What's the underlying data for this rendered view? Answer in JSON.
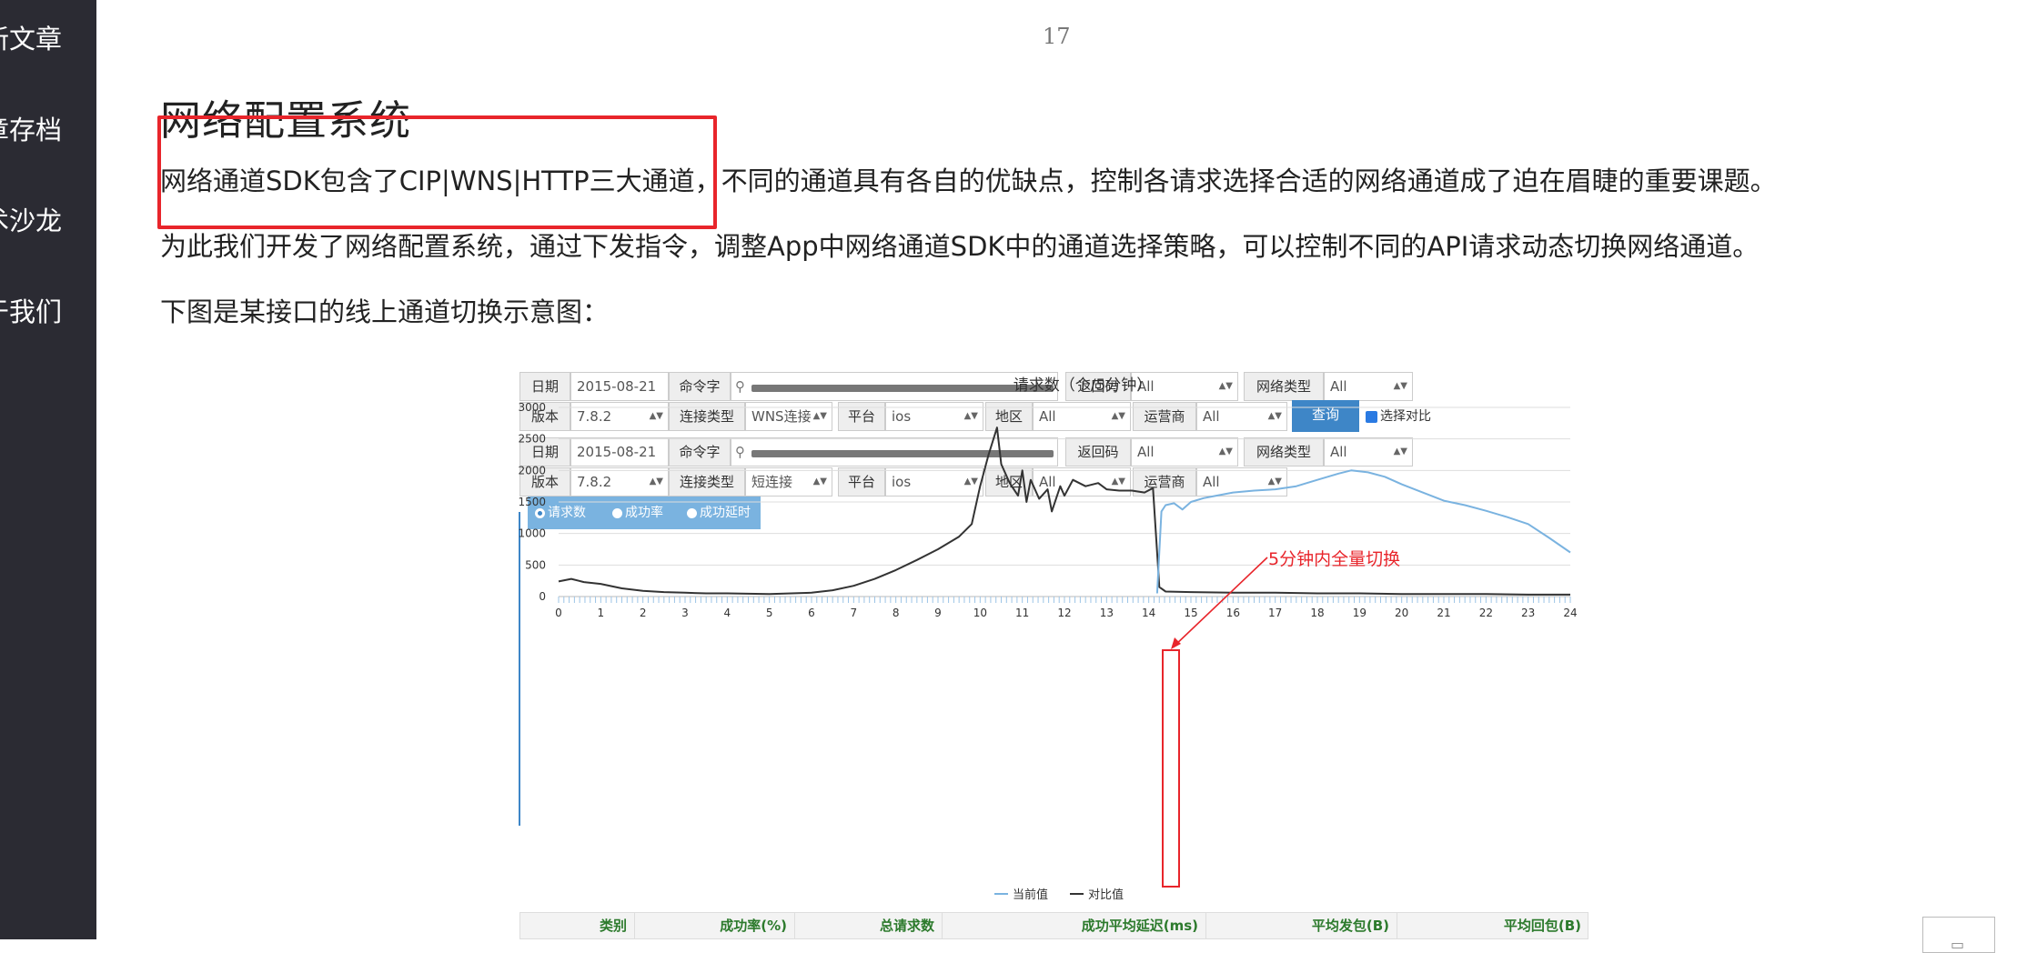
{
  "sidebar": {
    "items": [
      "新文章",
      "章存档",
      "术沙龙",
      "于我们"
    ]
  },
  "page_number": "17",
  "article": {
    "title": "网络配置系统",
    "paragraphs": [
      "网络通道SDK包含了CIP|WNS|HTTP三大通道，不同的通道具有各自的优缺点，控制各请求选择合适的网络通道成了迫在眉睫的重要课题。",
      "为此我们开发了网络配置系统，通过下发指令，调整App中网络通道SDK中的通道选择策略，可以控制不同的API请求动态切换网络通道。",
      "下图是某接口的线上通道切换示意图："
    ]
  },
  "filters": {
    "labels": {
      "date": "日期",
      "command": "命令字",
      "return_code": "返回码",
      "network_type": "网络类型",
      "version": "版本",
      "connection_type": "连接类型",
      "platform": "平台",
      "region": "地区",
      "carrier": "运营商"
    },
    "row1": {
      "date": "2015-08-21",
      "return_code": "All",
      "network_type": "All"
    },
    "row2": {
      "version": "7.8.2",
      "connection_type": "WNS连接",
      "platform": "ios",
      "region": "All",
      "carrier": "All"
    },
    "row3": {
      "date": "2015-08-21",
      "return_code": "All",
      "network_type": "All"
    },
    "row4": {
      "version": "7.8.2",
      "connection_type": "短连接",
      "platform": "ios",
      "region": "All",
      "carrier": "All"
    },
    "query_button": "查询",
    "compare_label": "选择对比"
  },
  "tabs": [
    {
      "label": "请求数",
      "selected": true
    },
    {
      "label": "成功率",
      "selected": false
    },
    {
      "label": "成功延时",
      "selected": false
    }
  ],
  "annotation": "5分钟内全量切换",
  "chart_data": {
    "type": "line",
    "title": "请求数（个/5分钟）",
    "x_ticks": [
      "0",
      "1",
      "2",
      "3",
      "4",
      "5",
      "6",
      "7",
      "8",
      "9",
      "10",
      "11",
      "12",
      "13",
      "14",
      "15",
      "16",
      "17",
      "18",
      "19",
      "20",
      "21",
      "22",
      "23",
      "24"
    ],
    "y_ticks": [
      "0",
      "500",
      "1000",
      "1500",
      "2000",
      "2500",
      "3000"
    ],
    "xlim": [
      0,
      24
    ],
    "ylim": [
      0,
      3000
    ],
    "grid": true,
    "legend_position": "bottom",
    "series": [
      {
        "name": "当前值",
        "color": "#7ab3e0",
        "x": [
          14.2,
          14.3,
          14.4,
          14.6,
          14.8,
          15.0,
          15.3,
          15.6,
          16.0,
          16.5,
          17.0,
          17.5,
          18.0,
          18.5,
          18.8,
          19.2,
          19.6,
          20.0,
          20.5,
          21.0,
          21.5,
          22.0,
          22.5,
          23.0,
          23.5,
          24.0
        ],
        "y": [
          50,
          1350,
          1450,
          1480,
          1380,
          1500,
          1560,
          1600,
          1650,
          1680,
          1700,
          1750,
          1850,
          1950,
          2000,
          1970,
          1900,
          1780,
          1650,
          1520,
          1450,
          1360,
          1260,
          1150,
          930,
          700
        ]
      },
      {
        "name": "对比值",
        "color": "#333333",
        "x": [
          0,
          0.3,
          0.6,
          1,
          1.5,
          2,
          2.5,
          3,
          3.5,
          4,
          5,
          6,
          6.5,
          7,
          7.5,
          8,
          8.5,
          9,
          9.5,
          9.8,
          10,
          10.2,
          10.4,
          10.5,
          10.7,
          10.9,
          11.0,
          11.1,
          11.2,
          11.4,
          11.6,
          11.7,
          11.9,
          12.0,
          12.2,
          12.5,
          12.8,
          13.0,
          13.3,
          13.6,
          13.9,
          14.1,
          14.25,
          14.4,
          15,
          16,
          17,
          18,
          19,
          20,
          21,
          22,
          23,
          24
        ],
        "y": [
          240,
          280,
          230,
          200,
          130,
          90,
          70,
          60,
          50,
          50,
          40,
          60,
          100,
          170,
          280,
          420,
          580,
          750,
          950,
          1150,
          1750,
          2250,
          2680,
          2100,
          1800,
          1600,
          2000,
          1500,
          1850,
          1550,
          1700,
          1350,
          1750,
          1600,
          1850,
          1750,
          1800,
          1700,
          1680,
          1680,
          1650,
          1720,
          150,
          80,
          70,
          60,
          60,
          50,
          50,
          40,
          40,
          40,
          30,
          30
        ]
      }
    ]
  },
  "summary_headers": [
    "类别",
    "成功率(%)",
    "总请求数",
    "成功平均延迟(ms)",
    "平均发包(B)",
    "平均回包(B)"
  ]
}
